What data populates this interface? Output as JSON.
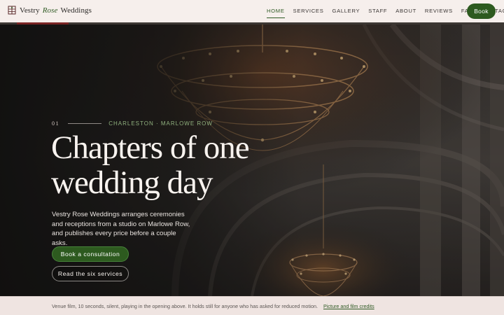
{
  "brand": {
    "name_part1": "Vestry",
    "name_part2": "Rose",
    "name_part3": "Weddings",
    "logo_icon": "crest-icon",
    "accent_color": "#2f5a24"
  },
  "nav": {
    "items": [
      {
        "label": "HOME",
        "active": true
      },
      {
        "label": "SERVICES",
        "active": false
      },
      {
        "label": "GALLERY",
        "active": false
      },
      {
        "label": "STAFF",
        "active": false
      },
      {
        "label": "ABOUT",
        "active": false
      },
      {
        "label": "REVIEWS",
        "active": false
      },
      {
        "label": "FAQ",
        "active": false
      },
      {
        "label": "CONTACT",
        "active": false
      }
    ],
    "book_label": "Book"
  },
  "hero": {
    "index": "01",
    "eyebrow": "CHARLESTON · MARLOWE ROW",
    "title_line1": "Chapters of one",
    "title_line2": "wedding day",
    "description": "Vestry Rose Weddings arranges ceremonies and receptions from a studio on Marlowe Row, and publishes every price before a couple asks.",
    "primary_cta": "Book a consultation",
    "secondary_cta": "Read the six services",
    "media_subject": "ballroom-chandelier-video"
  },
  "caption": {
    "text": "Venue film, 10 seconds, silent, playing in the opening above. It holds still for anyone who has asked for reduced motion.",
    "link_label": "Picture and film credits"
  },
  "colors": {
    "primary_green": "#2d5a1f",
    "header_bg": "#f6efec",
    "caption_bg": "#efe4e1",
    "accent_red": "#7a2424"
  }
}
